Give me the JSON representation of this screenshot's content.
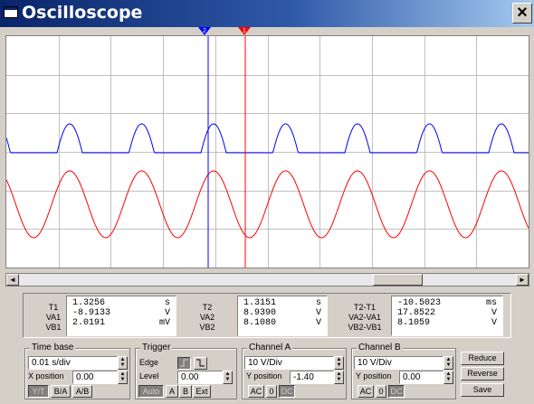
{
  "window": {
    "title": "Oscilloscope",
    "close_glyph": "×"
  },
  "cursors": {
    "cursor_1_label": "1",
    "cursor_2_label": "2"
  },
  "readout": {
    "t1": {
      "labels": [
        "T1",
        "VA1",
        "VB1"
      ],
      "values": [
        "1.3256",
        "-8.9133",
        "2.0191"
      ],
      "units": [
        "s",
        "V",
        "mV"
      ]
    },
    "t2": {
      "labels": [
        "T2",
        "VA2",
        "VB2"
      ],
      "values": [
        "1.3151",
        "8.9390",
        "8.1080"
      ],
      "units": [
        "s",
        "V",
        "V"
      ]
    },
    "diff": {
      "labels": [
        "T2-T1",
        "VA2-VA1",
        "VB2-VB1"
      ],
      "values": [
        "-10.5023",
        "17.8522",
        "8.1059"
      ],
      "units": [
        "ms",
        "V",
        "V"
      ]
    }
  },
  "timebase": {
    "title": "Time base",
    "scale": "0.01 s/div",
    "x_position_label": "X position",
    "x_position": "0.00",
    "mode_buttons": [
      "Y/T",
      "B/A",
      "A/B"
    ]
  },
  "trigger": {
    "title": "Trigger",
    "edge_label": "Edge",
    "level_label": "Level",
    "level": "0.00",
    "source_buttons": [
      "Auto",
      "A",
      "B",
      "Ext"
    ]
  },
  "channel_a": {
    "title": "Channel A",
    "scale": "10 V/Div",
    "y_position_label": "Y position",
    "y_position": "-1.40",
    "coupling_buttons": [
      "AC",
      "0",
      "DC"
    ]
  },
  "channel_b": {
    "title": "Channel B",
    "scale": "10 V/Div",
    "y_position_label": "Y position",
    "y_position": "0.00",
    "coupling_buttons": [
      "AC",
      "0",
      "DC"
    ]
  },
  "side_buttons": [
    "Reduce",
    "Reverse",
    "Save"
  ],
  "colors": {
    "channel_a": "#ff0000",
    "channel_b": "#0000ff",
    "title_bar": "#0a246a"
  },
  "icons": {
    "edge_rising": "rising-edge-icon",
    "edge_falling": "falling-edge-icon"
  }
}
